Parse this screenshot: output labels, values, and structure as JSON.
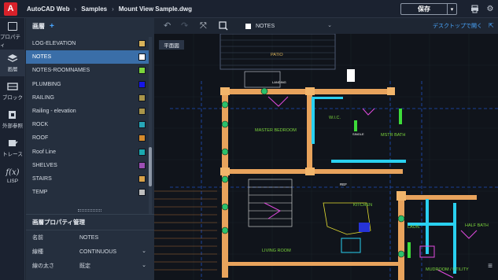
{
  "titlebar": {
    "logo": "A",
    "crumbs": [
      "AutoCAD Web",
      "Samples",
      "Mount View Sample.dwg"
    ],
    "save_label": "保存"
  },
  "rail": [
    {
      "label": "プロパティ",
      "icon": "properties-icon"
    },
    {
      "label": "画層",
      "icon": "layers-icon"
    },
    {
      "label": "ブロック",
      "icon": "block-icon"
    },
    {
      "label": "外部参照",
      "icon": "xref-icon"
    },
    {
      "label": "トレース",
      "icon": "trace-icon"
    },
    {
      "label": "LISP",
      "icon": "lisp-icon"
    }
  ],
  "layers_panel": {
    "title": "画層",
    "add": "+",
    "items": [
      {
        "name": "LOG-ELEVATION",
        "color": "#d9b35a"
      },
      {
        "name": "NOTES",
        "color": "#ffffff"
      },
      {
        "name": "NOTES-ROOMNAMES",
        "color": "#7bd53c"
      },
      {
        "name": "PLUMBING",
        "color": "#1616e8"
      },
      {
        "name": "RAILING",
        "color": "#a9954a"
      },
      {
        "name": "Railing - elevation",
        "color": "#a9954a"
      },
      {
        "name": "ROCK",
        "color": "#27a6b8"
      },
      {
        "name": "ROOF",
        "color": "#d48a2c"
      },
      {
        "name": "Roof Line",
        "color": "#1ba9b0"
      },
      {
        "name": "SHELVES",
        "color": "#9c4fb4"
      },
      {
        "name": "STAIRS",
        "color": "#d8a24a"
      },
      {
        "name": "TEMP",
        "color": "#bfbfbf"
      }
    ],
    "selected": "NOTES"
  },
  "props_panel": {
    "title": "画層プロパティ管理",
    "rows": [
      {
        "label": "名前",
        "value": "NOTES"
      },
      {
        "label": "線種",
        "value": "CONTINUOUS"
      },
      {
        "label": "線の太さ",
        "value": "既定"
      }
    ]
  },
  "canvas": {
    "current_layer": "NOTES",
    "desktop_link": "デスクトップで開く",
    "view_tab": "平面図",
    "labels": {
      "patio": "PATIO",
      "landing": "LANDING",
      "master_bedroom": "MASTER BEDROOM",
      "wic": "W.I.C.",
      "mstr_bath": "MSTR BATH",
      "kitchen": "KITCHEN",
      "living_room": "LIVING ROOM",
      "laun": "LAUN.",
      "half_bath": "HALF BATH",
      "mudroom": "MUDROOM / UTILITY",
      "ref": "REF",
      "single": "SINGLE"
    }
  }
}
